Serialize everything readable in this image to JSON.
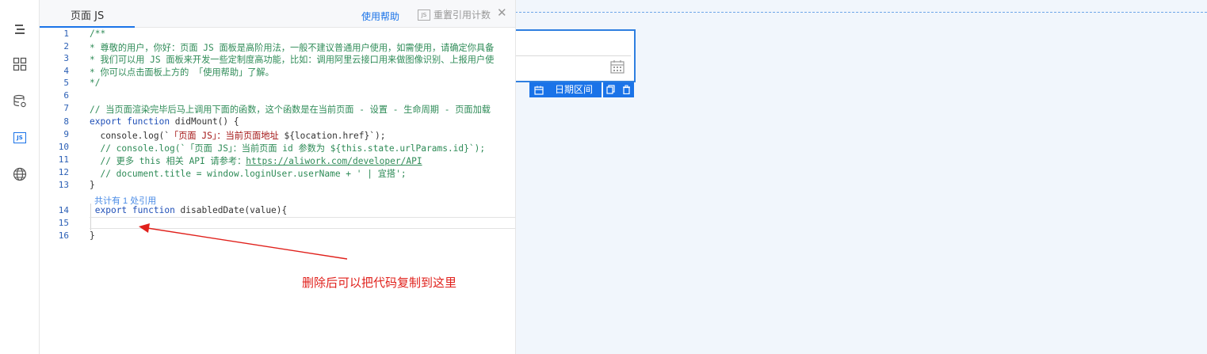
{
  "panel": {
    "title": "页面 JS",
    "help_label": "使用帮助",
    "reset_label": "重置引用计数",
    "reset_icon_text": "JS",
    "close_icon": "close-icon"
  },
  "toolbar": {
    "icons": [
      "outline-icon",
      "components-icon",
      "datasource-icon",
      "js-icon",
      "globe-icon"
    ],
    "js_icon_text": "JS"
  },
  "code": {
    "line_numbers": [
      "1",
      "2",
      "3",
      "4",
      "5",
      "6",
      "7",
      "8",
      "9",
      "10",
      "11",
      "12",
      "13",
      "14",
      "15",
      "16"
    ],
    "lines": [
      "/**",
      "* 尊敬的用户，你好：页面 JS 面板是高阶用法，一般不建议普通用户使用，如需使用，请确定你具备",
      "* 我们可以用 JS 面板来开发一些定制度高功能，比如：调用阿里云接口用来做图像识别、上报用户使",
      "* 你可以点击面板上方的 「使用帮助」了解。",
      "*/",
      "",
      "// 当页面渲染完毕后马上调用下面的函数，这个函数是在当前页面 - 设置 - 生命周期 - 页面加载",
      "export function didMount() {",
      "  console.log(`「页面 JS」：当前页面地址 ${location.href}`);",
      "  // console.log(`「页面 JS」：当前页面 id 参数为 ${this.state.urlParams.id}`);",
      "  // 更多 this 相关 API 请参考：https://aliwork.com/developer/API",
      "  // document.title = window.loginUser.userName + ' | 宜搭';",
      "}",
      " export function disabledDate(value){",
      "",
      "}"
    ],
    "codelens": "共计有 1 处引用",
    "tokens": {
      "export": "export",
      "function": "function",
      "didmount_rest": " didMount() {",
      "console_a": "  console.log(`",
      "console_str": "「页面 JS」：当前页面地址",
      "console_b": " ${location.href}`);",
      "c10": "  // console.log(`「页面 JS」：当前页面 id 参数为 ${this.state.urlParams.id}`);",
      "c11_a": "  // 更多 this 相关 API 请参考：",
      "c11_url": "https://aliwork.com/developer/API",
      "c12": "  // document.title = window.loginUser.userName + ' | 宜搭';",
      "l14_rest": " disabledDate(value){"
    }
  },
  "canvas": {
    "component_label": "日期区间"
  },
  "annotation": {
    "text": "删除后可以把代码复制到这里",
    "color": "#e0201b"
  },
  "colors": {
    "accent": "#1a73e8",
    "comment": "#2e8b57",
    "keyword": "#1f4fb7"
  }
}
